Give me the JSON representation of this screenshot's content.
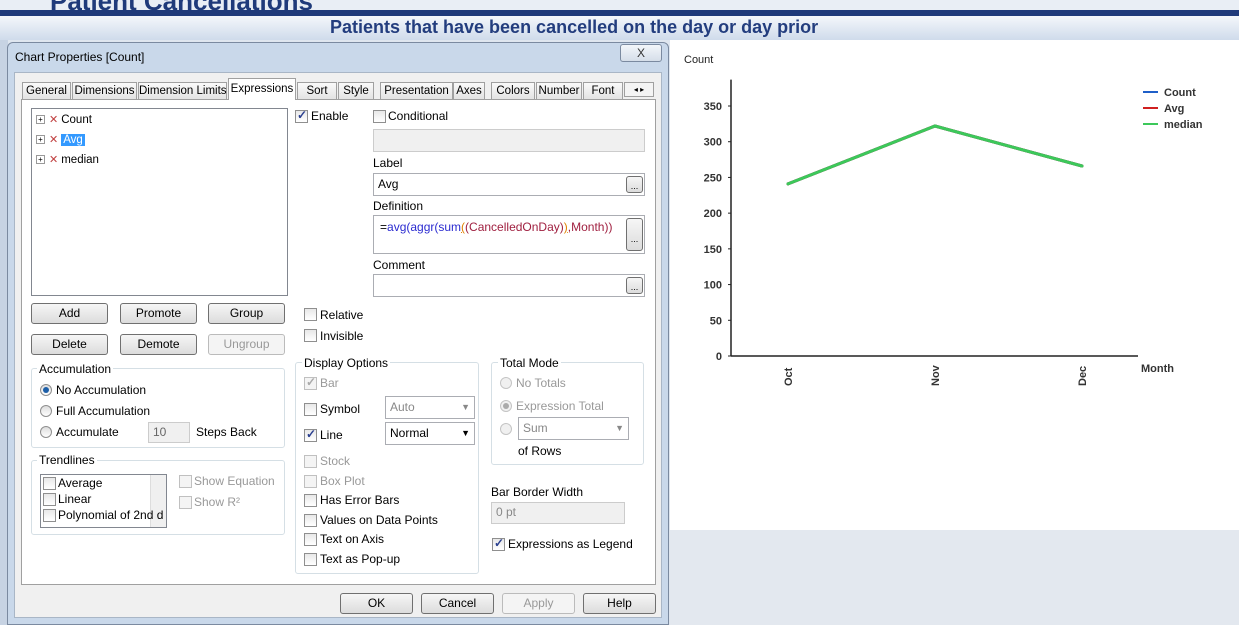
{
  "app": {
    "title": "Patient Cancellations",
    "chart_title": "Patients that have been cancelled on the day or day prior"
  },
  "dialog": {
    "title": "Chart Properties [Count]",
    "close_label": "X",
    "tabs": [
      "General",
      "Dimensions",
      "Dimension Limits",
      "Expressions",
      "Sort",
      "Style",
      "Presentation",
      "Axes",
      "Colors",
      "Number",
      "Font"
    ],
    "selected_tab": "Expressions",
    "expressions": [
      {
        "label": "Count",
        "selected": false
      },
      {
        "label": "Avg",
        "selected": true
      },
      {
        "label": "median",
        "selected": false
      }
    ],
    "buttons": {
      "add": "Add",
      "promote": "Promote",
      "group": "Group",
      "delete": "Delete",
      "demote": "Demote",
      "ungroup": "Ungroup"
    },
    "enable": {
      "label": "Enable",
      "checked": true
    },
    "conditional": {
      "label": "Conditional",
      "checked": false,
      "value": ""
    },
    "label_field": {
      "label": "Label",
      "value": "Avg"
    },
    "definition": {
      "label": "Definition",
      "prefix": "=",
      "fn1": "avg(",
      "fn2": "aggr(",
      "fn3": "sum",
      "b1": "(",
      "field": "(CancelledOnDay)",
      "b2": ")",
      "rest": ",Month))"
    },
    "comment": {
      "label": "Comment",
      "value": ""
    },
    "ellipsis": "...",
    "relative": {
      "label": "Relative",
      "checked": false
    },
    "invisible": {
      "label": "Invisible",
      "checked": false
    },
    "accumulation": {
      "title": "Accumulation",
      "options": [
        "No Accumulation",
        "Full Accumulation",
        "Accumulate"
      ],
      "selected": "No Accumulation",
      "steps": "10",
      "steps_label": "Steps Back"
    },
    "trendlines": {
      "title": "Trendlines",
      "items": [
        "Average",
        "Linear",
        "Polynomial of 2nd d"
      ],
      "show_equation": "Show Equation",
      "show_r2": "Show R²"
    },
    "display_options": {
      "title": "Display Options",
      "bar": "Bar",
      "symbol": "Symbol",
      "symbol_value": "Auto",
      "line": "Line",
      "line_value": "Normal",
      "stock": "Stock",
      "box_plot": "Box Plot",
      "error_bars": "Has Error Bars",
      "values_on_points": "Values on Data Points",
      "text_on_axis": "Text on Axis",
      "text_popup": "Text as Pop-up"
    },
    "total_mode": {
      "title": "Total Mode",
      "no_totals": "No Totals",
      "expression_total": "Expression Total",
      "sum": "Sum",
      "of_rows": "of Rows"
    },
    "bar_border": {
      "label": "Bar Border Width",
      "value": "0 pt"
    },
    "expressions_legend": {
      "label": "Expressions as Legend",
      "checked": true
    },
    "footer": {
      "ok": "OK",
      "cancel": "Cancel",
      "apply": "Apply",
      "help": "Help"
    }
  },
  "chart_data": {
    "type": "line",
    "ylabel": "Count",
    "xlabel": "Month",
    "categories": [
      "Oct",
      "Nov",
      "Dec"
    ],
    "ylim": [
      0,
      380
    ],
    "yticks": [
      0,
      50,
      100,
      150,
      200,
      250,
      300,
      350
    ],
    "series": [
      {
        "name": "Count",
        "color": "#1f5fc8",
        "values": [
          241,
          322,
          266
        ]
      },
      {
        "name": "Avg",
        "color": "#d02020",
        "values": [
          241,
          322,
          266
        ]
      },
      {
        "name": "median",
        "color": "#3cc85a",
        "values": [
          241,
          322,
          266
        ]
      }
    ],
    "legend": "top-right",
    "grid": false
  }
}
